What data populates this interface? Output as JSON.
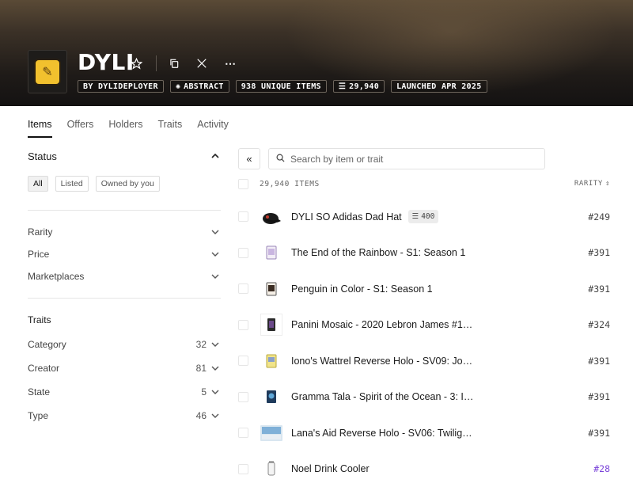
{
  "collection": {
    "title": "DYLI",
    "chips": [
      {
        "icon": "",
        "label": "BY DYLIDEPLOYER"
      },
      {
        "icon": "abstract-icon",
        "label": "ABSTRACT"
      },
      {
        "icon": "",
        "label": "938 UNIQUE ITEMS"
      },
      {
        "icon": "stack-icon",
        "label": "29,940"
      },
      {
        "icon": "",
        "label": "LAUNCHED APR 2025"
      }
    ]
  },
  "tabs": [
    "Items",
    "Offers",
    "Holders",
    "Traits",
    "Activity"
  ],
  "sidebar": {
    "status_title": "Status",
    "status_filters": [
      "All",
      "Listed",
      "Owned by you"
    ],
    "groups": [
      "Rarity",
      "Price",
      "Marketplaces"
    ],
    "traits_title": "Traits",
    "traits": [
      {
        "label": "Category",
        "count": "32"
      },
      {
        "label": "Creator",
        "count": "81"
      },
      {
        "label": "State",
        "count": "5"
      },
      {
        "label": "Type",
        "count": "46"
      }
    ]
  },
  "search": {
    "placeholder": "Search by item or trait"
  },
  "list": {
    "count_label": "29,940 ITEMS",
    "rarity_label": "RARITY",
    "items": [
      {
        "name": "DYLI SO Adidas Dad Hat",
        "badge": "400",
        "rank": "#249",
        "thumb": "hat-thumbnail"
      },
      {
        "name": "The End of the Rainbow - S1: Season 1",
        "badge": "",
        "rank": "#391",
        "thumb": "card-thumbnail"
      },
      {
        "name": "Penguin in Color - S1: Season 1",
        "badge": "",
        "rank": "#391",
        "thumb": "card-thumbnail"
      },
      {
        "name": "Panini Mosaic - 2020 Lebron James #10 ...",
        "badge": "",
        "rank": "#324",
        "thumb": "card-thumbnail"
      },
      {
        "name": "Iono's Wattrel Reverse Holo - SV09: Jour...",
        "badge": "",
        "rank": "#391",
        "thumb": "card-thumbnail"
      },
      {
        "name": "Gramma Tala - Spirit of the Ocean - 3: In...",
        "badge": "",
        "rank": "#391",
        "thumb": "card-thumbnail"
      },
      {
        "name": "Lana's Aid Reverse Holo - SV06: Twilight...",
        "badge": "",
        "rank": "#391",
        "thumb": "card-thumbnail"
      },
      {
        "name": "Noel Drink Cooler",
        "badge": "",
        "rank": "#28",
        "thumb": "cooler-thumbnail"
      }
    ]
  },
  "colors": {
    "rank_highlight": "#7a43d9"
  }
}
